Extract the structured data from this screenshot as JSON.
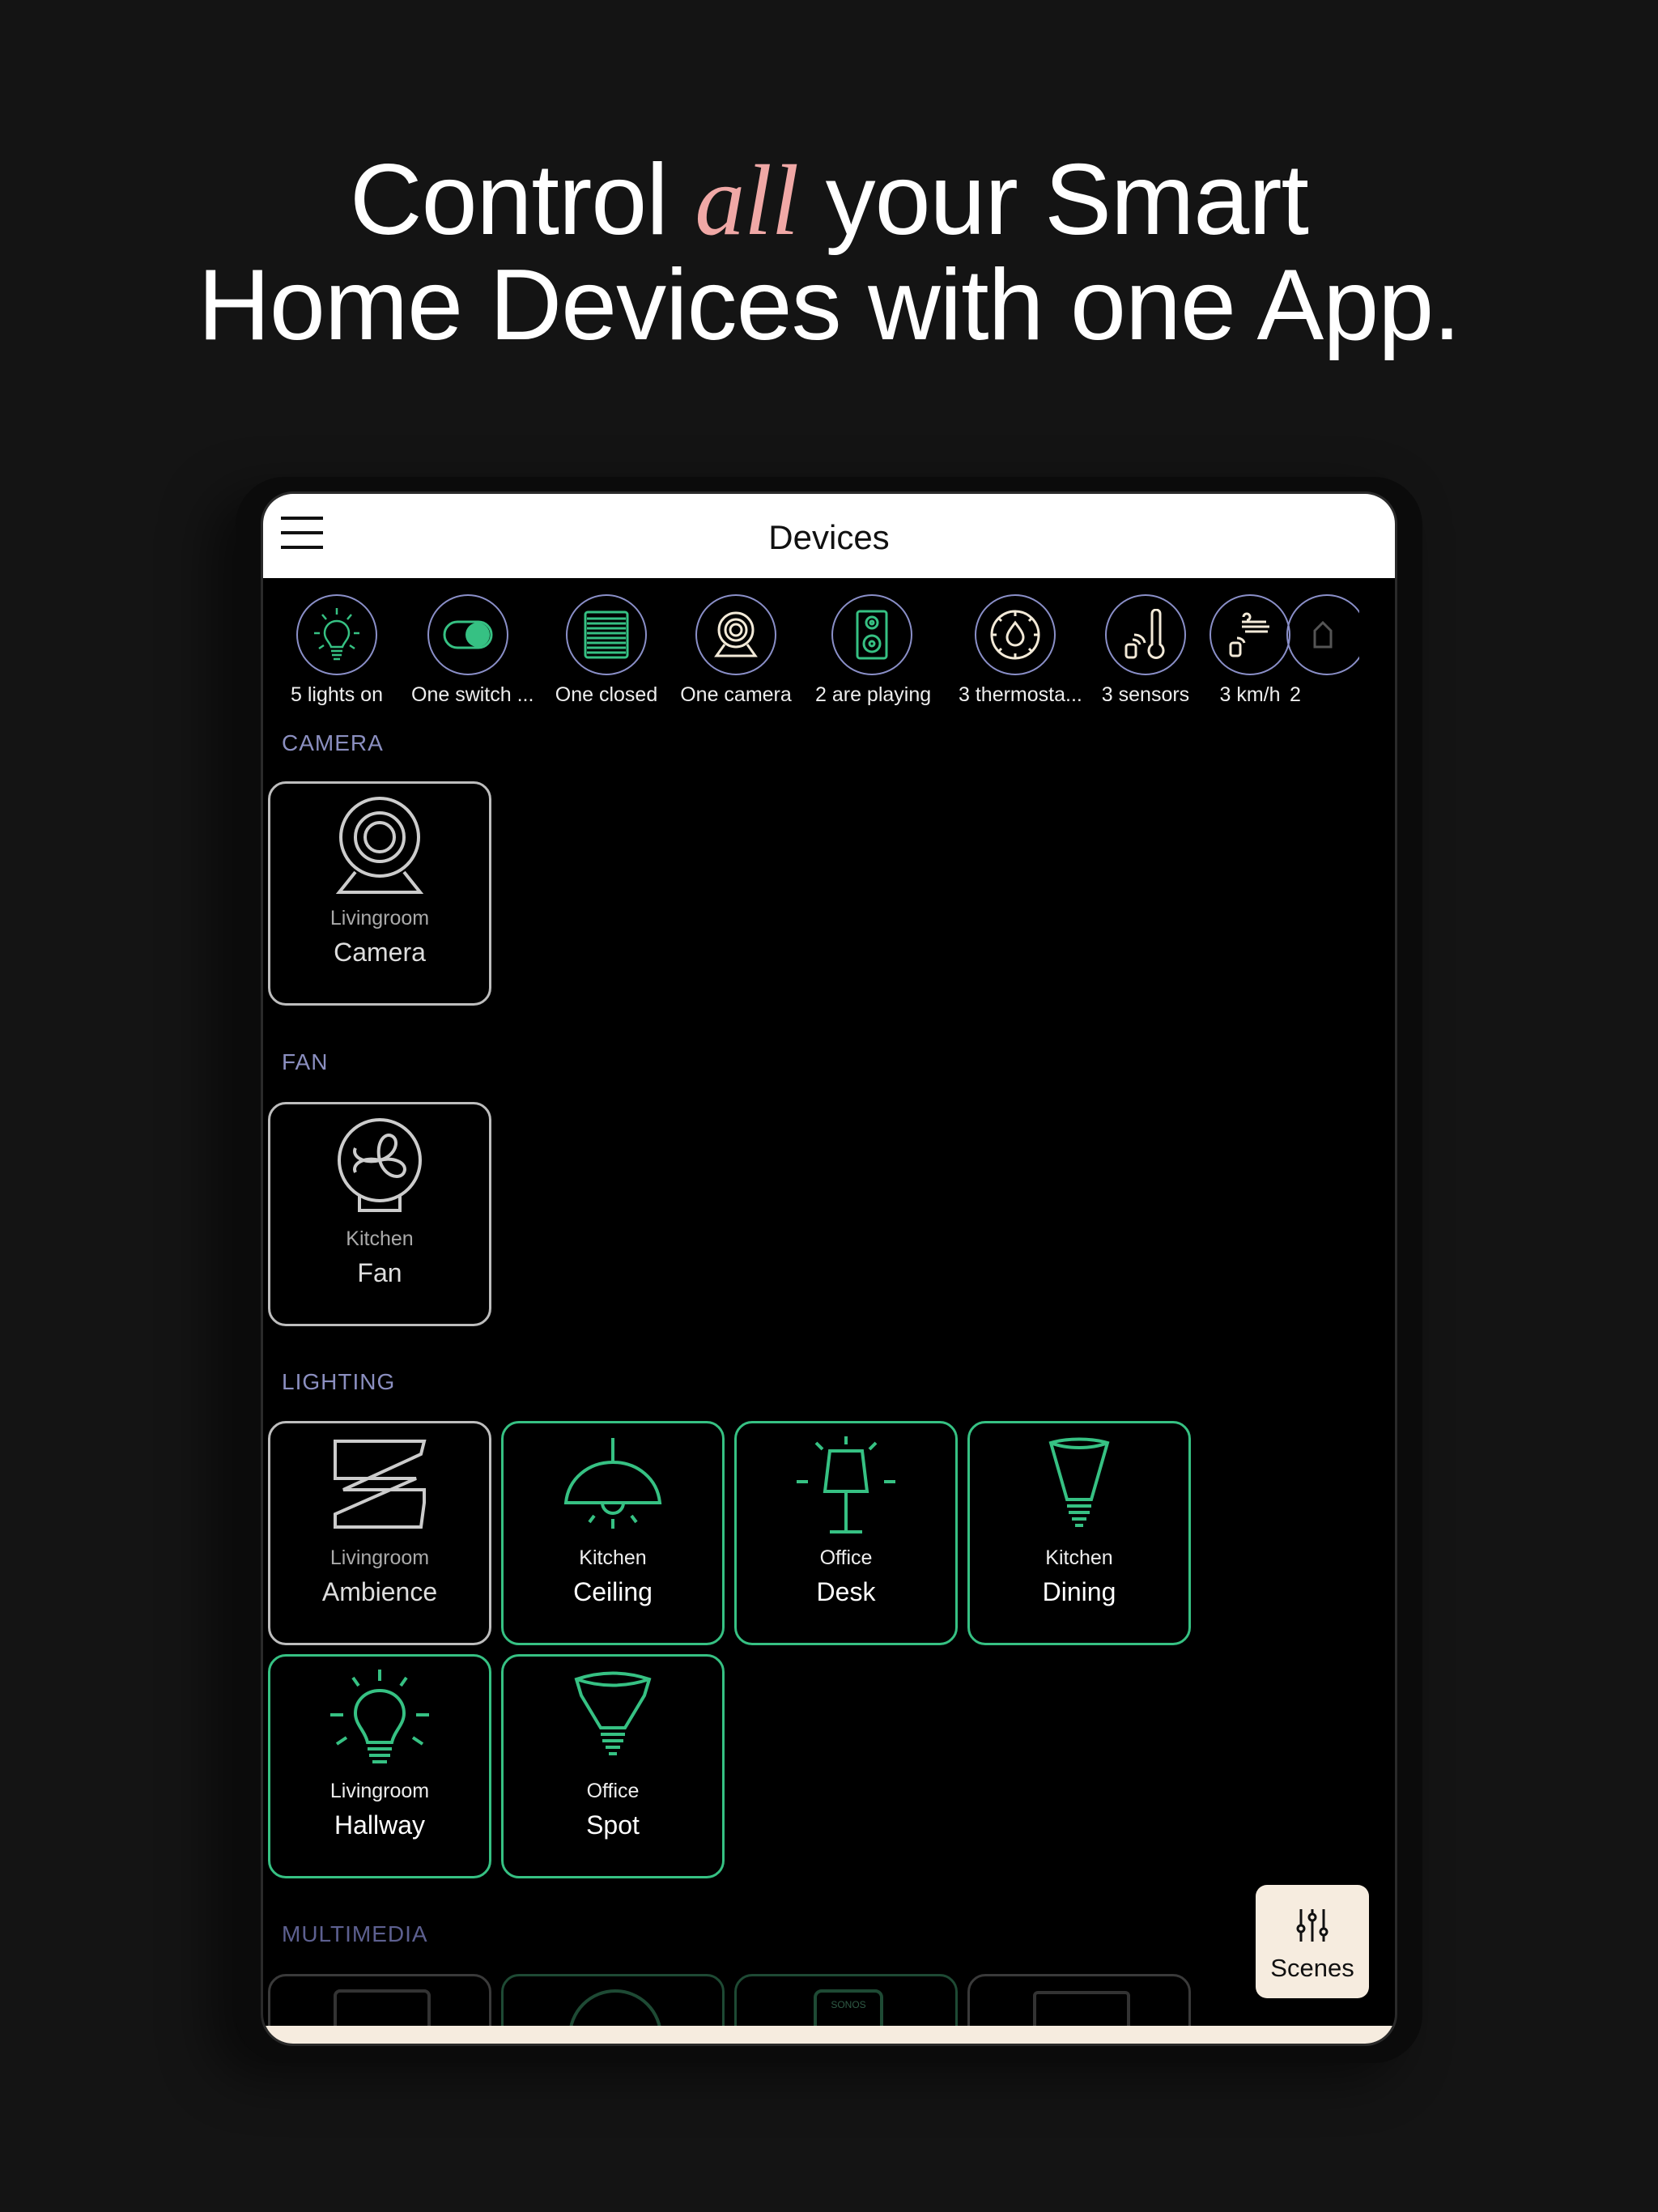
{
  "headline": {
    "line1_pre": "Control ",
    "line1_accent": "all",
    "line1_post": " your Smart",
    "line2": "Home Devices with one App."
  },
  "header": {
    "title": "Devices",
    "menu_icon": "hamburger-icon"
  },
  "status": [
    {
      "label": "5 lights on",
      "icon": "lightbulb-icon"
    },
    {
      "label": "One switch ...",
      "icon": "toggle-icon"
    },
    {
      "label": "One closed",
      "icon": "blinds-icon"
    },
    {
      "label": "One camera",
      "icon": "camera-icon"
    },
    {
      "label": "2 are playing",
      "icon": "speaker-icon"
    },
    {
      "label": "3 thermosta...",
      "icon": "thermostat-icon"
    },
    {
      "label": "3 sensors",
      "icon": "thermometer-sensor-icon"
    },
    {
      "label": "3  km/h",
      "icon": "wind-icon"
    },
    {
      "label": "2",
      "icon": "hand-icon"
    }
  ],
  "sections": {
    "camera": {
      "title": "CAMERA",
      "devices": [
        {
          "room": "Livingroom",
          "name": "Camera",
          "on": false
        }
      ]
    },
    "fan": {
      "title": "FAN",
      "devices": [
        {
          "room": "Kitchen",
          "name": "Fan",
          "on": false
        }
      ]
    },
    "lighting": {
      "title": "LIGHTING",
      "devices": [
        {
          "room": "Livingroom",
          "name": "Ambience",
          "on": false
        },
        {
          "room": "Kitchen",
          "name": "Ceiling",
          "on": true
        },
        {
          "room": "Office",
          "name": "Desk",
          "on": true
        },
        {
          "room": "Kitchen",
          "name": "Dining",
          "on": true
        },
        {
          "room": "Livingroom",
          "name": "Hallway",
          "on": true
        },
        {
          "room": "Office",
          "name": "Spot",
          "on": true
        }
      ]
    },
    "multimedia": {
      "title": "MULTIMEDIA",
      "sonos_text": "SONOS"
    }
  },
  "scenes": {
    "label": "Scenes"
  },
  "colors": {
    "accent_green": "#36c183",
    "section_label": "#8b8fc0",
    "highlight_pink": "#f0a8a6",
    "cream": "#f6ecdf"
  }
}
